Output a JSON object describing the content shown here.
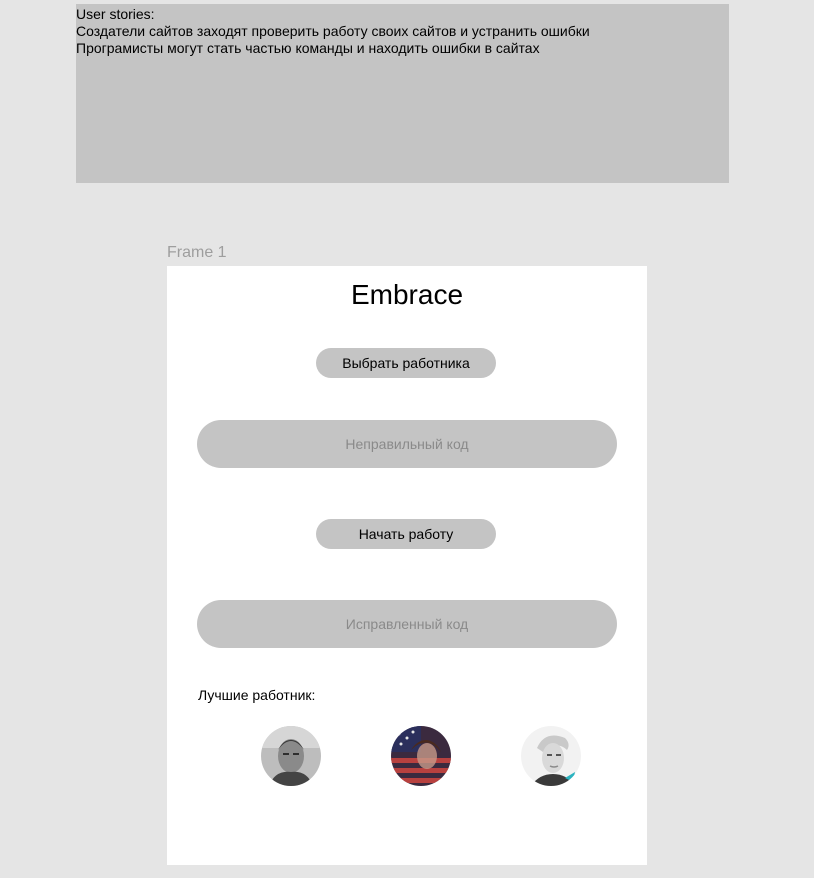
{
  "notes": {
    "line1": "User stories:",
    "line2": "Создатели сайтов заходят проверить работу своих сайтов и устранить ошибки",
    "line3": "Програмисты могут стать частью команды и находить ошибки в сайтах"
  },
  "frame": {
    "label": "Frame 1"
  },
  "app": {
    "title": "Embrace",
    "select_worker_label": "Выбрать работника",
    "wrong_code_placeholder": "Неправильный код",
    "start_work_label": "Начать работу",
    "fixed_code_placeholder": "Исправленный код",
    "best_workers_label": "Лучшие работник:"
  },
  "avatars": [
    {
      "icon": "avatar-photo-grayscale-man"
    },
    {
      "icon": "avatar-photo-flag-portrait"
    },
    {
      "icon": "avatar-photo-blonde-woman"
    }
  ],
  "colors": {
    "canvas": "#e5e5e5",
    "frame": "#ffffff",
    "control_fill": "#c4c4c4",
    "placeholder_text": "#8a8a8a",
    "frame_label": "#9e9e9e"
  }
}
